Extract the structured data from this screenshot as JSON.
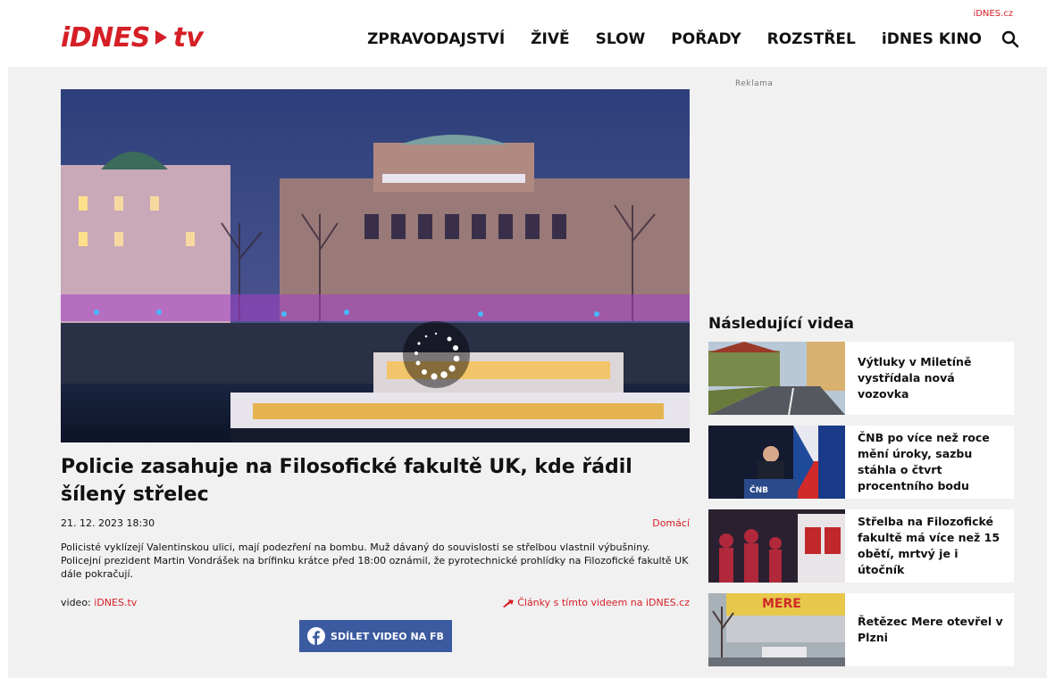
{
  "header": {
    "top_link": "iDNES.cz",
    "logo": {
      "brand": "iDNES",
      "suffix": "tv"
    },
    "nav": [
      "ZPRAVODAJSTVÍ",
      "ŽIVĚ",
      "SLOW",
      "POŘADY",
      "ROZSTŘEL",
      "iDNES KINO"
    ]
  },
  "article": {
    "title": "Policie zasahuje na Filosofické fakultě UK, kde řádil šílený střelec",
    "date": "21. 12. 2023 18:30",
    "category": "Domácí",
    "perex": "Policisté vyklízejí Valentinskou ulici, mají podezření na bombu. Muž dávaný do souvislosti se střelbou vlastnil výbušniny. Policejní prezident Martin Vondrášek na brífinku krátce před 18:00 oznámil, že pyrotechnické prohlídky na Filozofické fakultě UK dále pokračují.",
    "video_source_label": "video:",
    "video_source": "iDNES.tv",
    "articles_link": "Články s tímto videem na iDNES.cz",
    "share_button": "SDÍLET VIDEO NA FB"
  },
  "sidebar": {
    "ad_label": "Reklama",
    "heading": "Následující videa",
    "videos": [
      {
        "title": "Výtluky v Miletíně vystřídala nová vozovka"
      },
      {
        "title": "ČNB po více než roce mění úroky, sazbu stáhla o čtvrt procentního bodu",
        "thumb_text": "ČNB"
      },
      {
        "title": "Střelba na Filozofické fakultě má více než 15 obětí, mrtvý je i útočník"
      },
      {
        "title": "Řetězec Mere otevřel v Plzni",
        "thumb_text": "MERE"
      }
    ]
  },
  "colors": {
    "brand_red": "#d51f26",
    "facebook_blue": "#3b5aa0",
    "page_bg": "#f1f1f1"
  }
}
